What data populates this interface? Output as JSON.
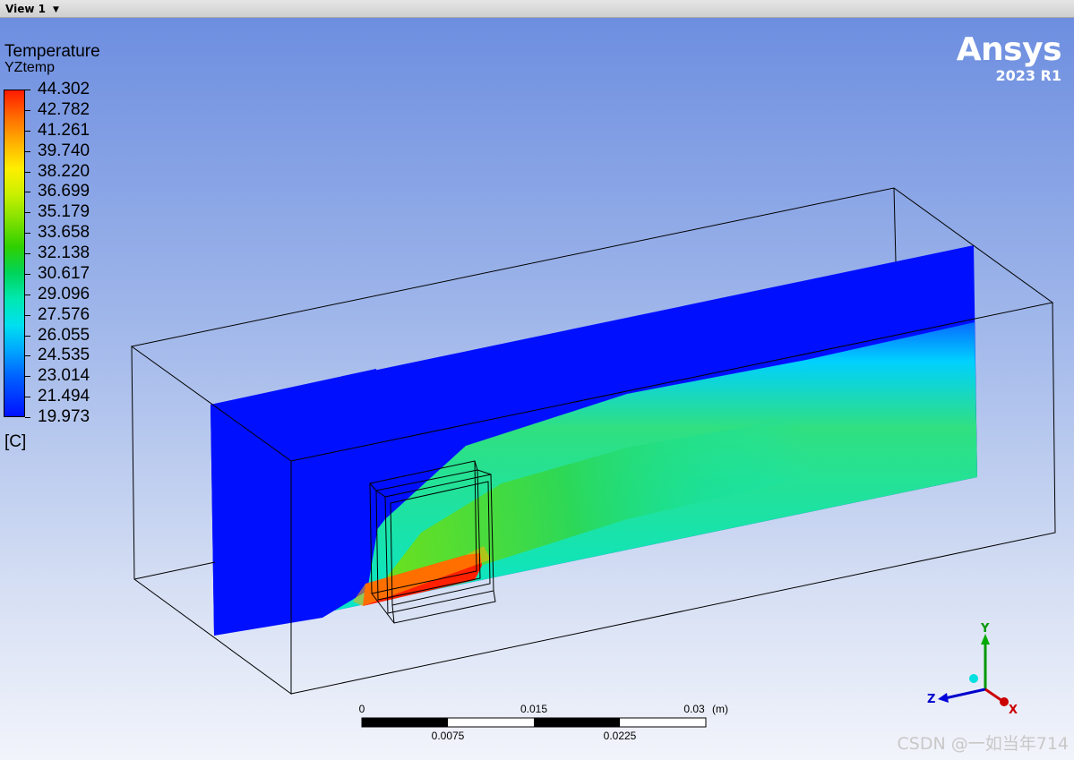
{
  "window": {
    "title": "View 1"
  },
  "legend": {
    "title": "Temperature",
    "variable": "YZtemp",
    "unit": "[C]",
    "max": 44.302,
    "min": 19.973,
    "values": [
      "44.302",
      "42.782",
      "41.261",
      "39.740",
      "38.220",
      "36.699",
      "35.179",
      "33.658",
      "32.138",
      "30.617",
      "29.096",
      "27.576",
      "26.055",
      "24.535",
      "23.014",
      "21.494",
      "19.973"
    ]
  },
  "logo": {
    "name": "Ansys",
    "version": "2023 R1"
  },
  "scale_bar": {
    "top_labels": [
      "0",
      "0.015",
      "0.03"
    ],
    "bottom_labels": [
      "0.0075",
      "0.0225"
    ],
    "unit": "(m)"
  },
  "axes": {
    "x": "X",
    "y": "Y",
    "z": "Z",
    "x_color": "#cc0000",
    "y_color": "#009900",
    "z_color": "#0000cc"
  },
  "watermark": "CSDN @一如当年714"
}
